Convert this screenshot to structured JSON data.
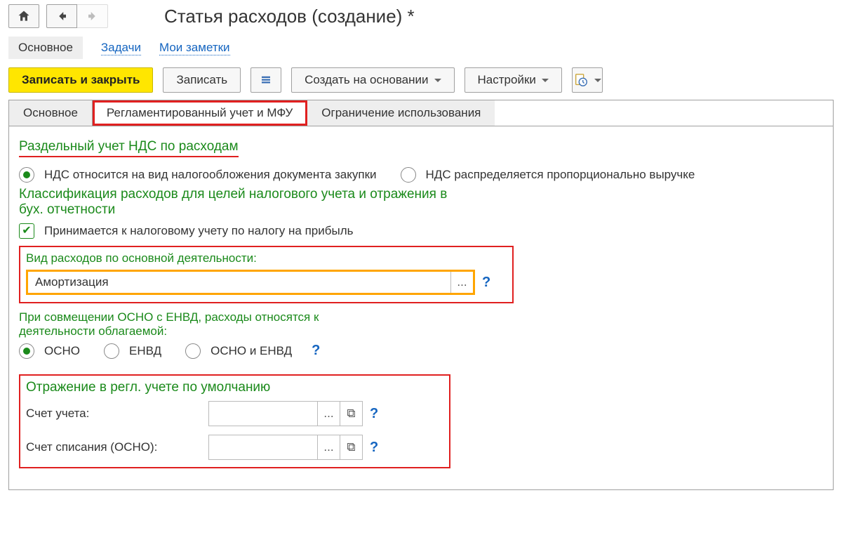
{
  "header": {
    "title": "Статья расходов (создание) *"
  },
  "links": {
    "main": "Основное",
    "tasks": "Задачи",
    "notes": "Мои заметки"
  },
  "toolbar": {
    "save_close": "Записать и закрыть",
    "save": "Записать",
    "create_based": "Создать на основании",
    "settings": "Настройки"
  },
  "tabs": {
    "t1": "Основное",
    "t2": "Регламентированный учет и МФУ",
    "t3": "Ограничение использования"
  },
  "sec_vat": {
    "title": "Раздельный учет НДС по расходам",
    "opt1": "НДС относится на вид налогообложения документа закупки",
    "opt2": "НДС распределяется пропорционально выручке"
  },
  "sec_class": {
    "title": "Классификация расходов для целей налогового учета и отражения в бух. отчетности",
    "chk": "Принимается к налоговому учету по налогу на прибыль"
  },
  "sec_kind": {
    "label": "Вид расходов по основной деятельности:",
    "value": "Амортизация"
  },
  "sec_combine": {
    "title": "При совмещении ОСНО с ЕНВД, расходы относятся к деятельности облагаемой:",
    "opt1": "ОСНО",
    "opt2": "ЕНВД",
    "opt3": "ОСНО и ЕНВД"
  },
  "sec_accounts": {
    "title": "Отражение в регл. учете по умолчанию",
    "acc_label": "Счет учета:",
    "write_label": "Счет списания (ОСНО):"
  },
  "glyph": {
    "dots": "...",
    "open": "⧉",
    "help": "?"
  }
}
